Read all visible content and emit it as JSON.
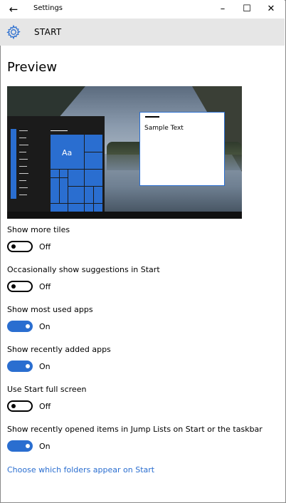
{
  "window": {
    "title": "Settings",
    "back_icon": "arrow-left-icon",
    "controls": {
      "minimize": "–",
      "maximize": "☐",
      "close": "✕"
    }
  },
  "header": {
    "icon": "gear-icon",
    "title": "START"
  },
  "preview": {
    "heading": "Preview",
    "tile_label": "Aa",
    "sample_text": "Sample Text"
  },
  "colors": {
    "accent": "#2a6ed0",
    "header_bg": "#e6e6e6"
  },
  "settings": [
    {
      "label": "Show more tiles",
      "state": "Off",
      "on": false
    },
    {
      "label": "Occasionally show suggestions in Start",
      "state": "Off",
      "on": false
    },
    {
      "label": "Show most used apps",
      "state": "On",
      "on": true
    },
    {
      "label": "Show recently added apps",
      "state": "On",
      "on": true
    },
    {
      "label": "Use Start full screen",
      "state": "Off",
      "on": false
    },
    {
      "label": "Show recently opened items in Jump Lists on Start or the taskbar",
      "state": "On",
      "on": true
    }
  ],
  "link": {
    "label": "Choose which folders appear on Start"
  }
}
